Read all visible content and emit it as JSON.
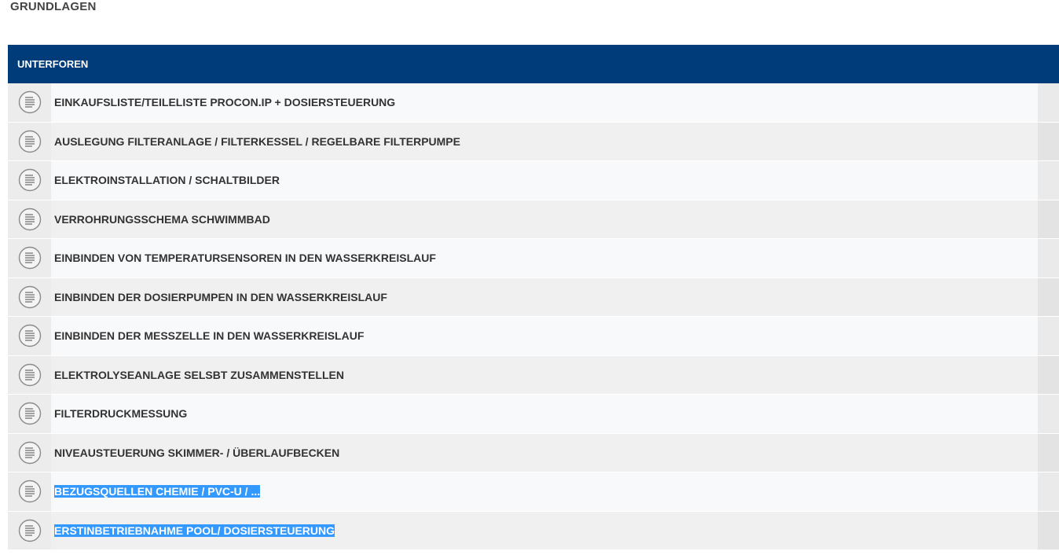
{
  "page": {
    "title": "GRUNDLAGEN"
  },
  "table": {
    "header": "UNTERFOREN",
    "rows": [
      {
        "label": "EINKAUFSLISTE/TEILELISTE PROCON.IP + DOSIERSTEUERUNG",
        "icon": "forum-doc-icon",
        "selected": false
      },
      {
        "label": "AUSLEGUNG FILTERANLAGE / FILTERKESSEL / REGELBARE FILTERPUMPE",
        "icon": "forum-doc-icon",
        "selected": false
      },
      {
        "label": "ELEKTROINSTALLATION / SCHALTBILDER",
        "icon": "forum-doc-icon",
        "selected": false
      },
      {
        "label": "VERROHRUNGSSCHEMA SCHWIMMBAD",
        "icon": "forum-doc-icon",
        "selected": false
      },
      {
        "label": "EINBINDEN VON TEMPERATURSENSOREN IN DEN WASSERKREISLAUF",
        "icon": "forum-doc-icon",
        "selected": false
      },
      {
        "label": "EINBINDEN DER DOSIERPUMPEN IN DEN WASSERKREISLAUF",
        "icon": "forum-doc-icon",
        "selected": false
      },
      {
        "label": "EINBINDEN DER MESSZELLE IN DEN WASSERKREISLAUF",
        "icon": "forum-doc-icon",
        "selected": false
      },
      {
        "label": "ELEKTROLYSEANLAGE SELSBT ZUSAMMENSTELLEN",
        "icon": "forum-doc-icon",
        "selected": false
      },
      {
        "label": "FILTERDRUCKMESSUNG",
        "icon": "forum-doc-icon",
        "selected": false
      },
      {
        "label": "NIVEAUSTEUERUNG SKIMMER- / ÜBERLAUFBECKEN",
        "icon": "forum-doc-icon",
        "selected": false
      },
      {
        "label": "BEZUGSQUELLEN CHEMIE / PVC-U / ...",
        "icon": "forum-doc-icon",
        "selected": true
      },
      {
        "label": "ERSTINBETRIEBNAHME POOL/ DOSIERSTEUERUNG",
        "icon": "forum-doc-icon",
        "selected": true
      }
    ]
  },
  "colors": {
    "header_bg": "#003b7a",
    "selection_bg": "#3399ff",
    "text": "#333333"
  }
}
